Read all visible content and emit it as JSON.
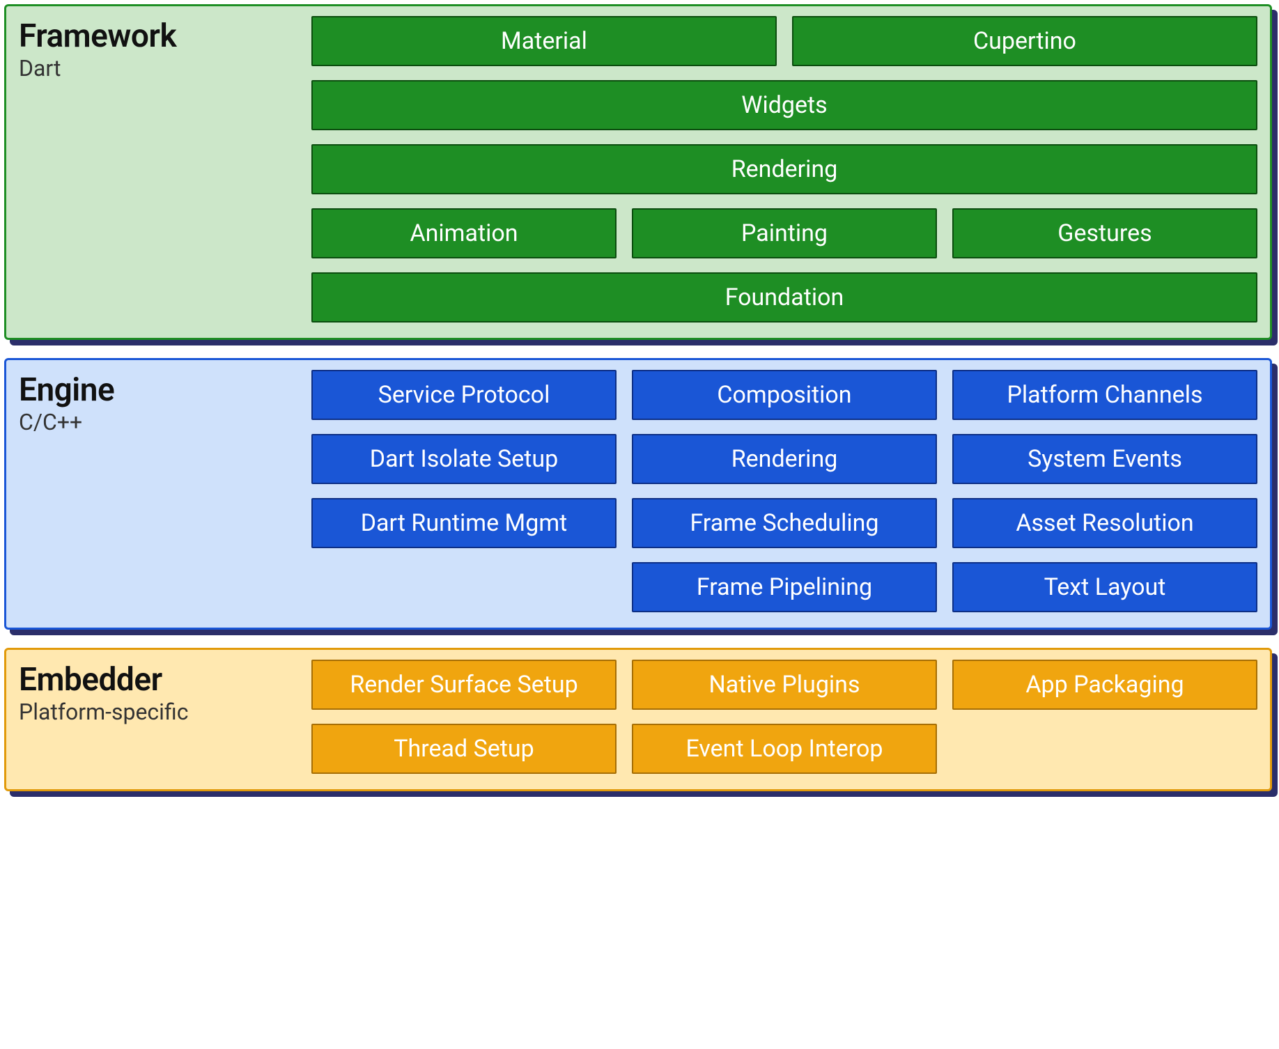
{
  "layers": {
    "framework": {
      "title": "Framework",
      "subtitle": "Dart",
      "rows": [
        [
          "Material",
          "Cupertino"
        ],
        [
          "Widgets"
        ],
        [
          "Rendering"
        ],
        [
          "Animation",
          "Painting",
          "Gestures"
        ],
        [
          "Foundation"
        ]
      ]
    },
    "engine": {
      "title": "Engine",
      "subtitle": "C/C++",
      "rows": [
        [
          "Service Protocol",
          "Composition",
          "Platform Channels"
        ],
        [
          "Dart Isolate Setup",
          "Rendering",
          "System Events"
        ],
        [
          "Dart Runtime Mgmt",
          "Frame Scheduling",
          "Asset Resolution"
        ],
        [
          "",
          "Frame Pipelining",
          "Text Layout"
        ]
      ]
    },
    "embedder": {
      "title": "Embedder",
      "subtitle": "Platform-specific",
      "rows": [
        [
          "Render Surface Setup",
          "Native Plugins",
          "App Packaging"
        ],
        [
          "Thread Setup",
          "Event Loop Interop",
          ""
        ]
      ]
    }
  }
}
